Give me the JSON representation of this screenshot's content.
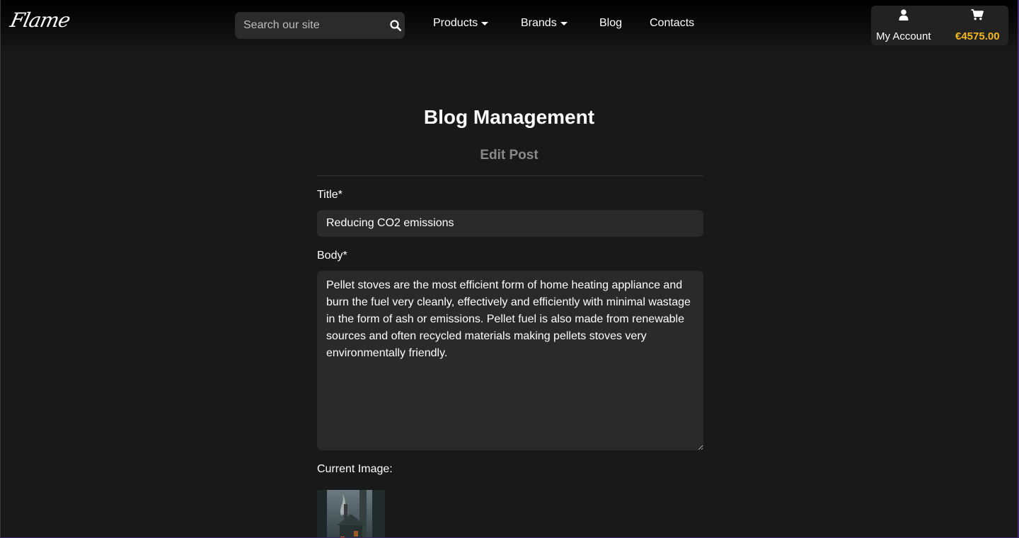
{
  "brand": {
    "logo_text": "Flame"
  },
  "search": {
    "placeholder": "Search our site"
  },
  "nav": {
    "products": "Products",
    "brands": "Brands",
    "blog": "Blog",
    "contacts": "Contacts"
  },
  "account": {
    "label": "My Account",
    "cart_total": "€4575.00"
  },
  "page": {
    "title": "Blog Management",
    "subtitle": "Edit Post"
  },
  "form": {
    "title_label": "Title*",
    "title_value": "Reducing CO2 emissions",
    "body_label": "Body*",
    "body_value": "Pellet stoves are the most efficient form of home heating appliance and burn the fuel very cleanly, effectively and efficiently with minimal wastage in the form of ash or emissions. Pellet fuel is also made from renewable sources and often recycled materials making pellets stoves very environmentally friendly.",
    "current_image_label": "Current Image:"
  },
  "colors": {
    "background": "#191919",
    "input_bg": "#2a2a2a",
    "cart_accent": "#f5b81c",
    "muted_text": "#8a8a8a"
  },
  "icons": {
    "search": "search-icon",
    "account": "user-icon",
    "cart": "cart-icon"
  }
}
